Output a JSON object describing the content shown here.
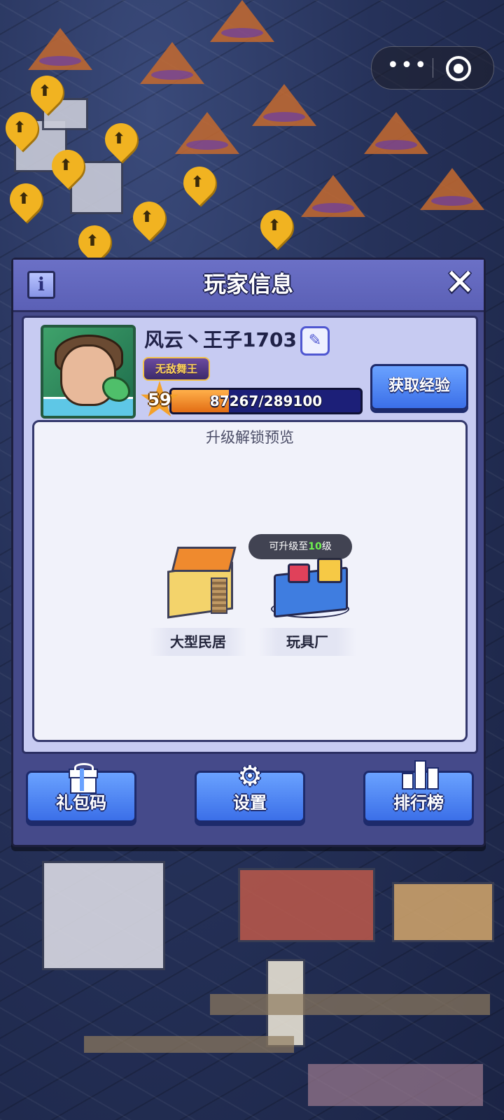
{
  "capsule": {
    "more_label": "•••",
    "more_icon": "more-dots-icon",
    "target_icon": "target-circle-icon"
  },
  "dialog": {
    "title": "玩家信息",
    "info_label": "i",
    "close_label": "✕"
  },
  "player": {
    "name": "风云丶王子1703",
    "edit_icon": "✎",
    "title_badge": "无敌舞王",
    "level": "59",
    "exp_text": "87267/289100",
    "exp_current": 87267,
    "exp_max": 289100,
    "gain_exp_label": "获取经验"
  },
  "preview": {
    "title": "升级解锁预览",
    "items": [
      {
        "label": "大型民居",
        "icon": "house-building-icon"
      },
      {
        "label": "玩具厂",
        "icon": "toy-factory-icon",
        "tip_prefix": "可升级至",
        "tip_level": "10",
        "tip_suffix": "级"
      }
    ]
  },
  "buttons": {
    "gift_code": "礼包码",
    "settings": "设置",
    "settings_icon": "⚙",
    "leaderboard": "排行榜"
  },
  "colors": {
    "dialog_bg": "#454a8a",
    "header_bg": "#5b60b6",
    "button_blue": "#3b6fe8",
    "exp_fill": "#e26d14",
    "highlight_green": "#6ef04f"
  }
}
